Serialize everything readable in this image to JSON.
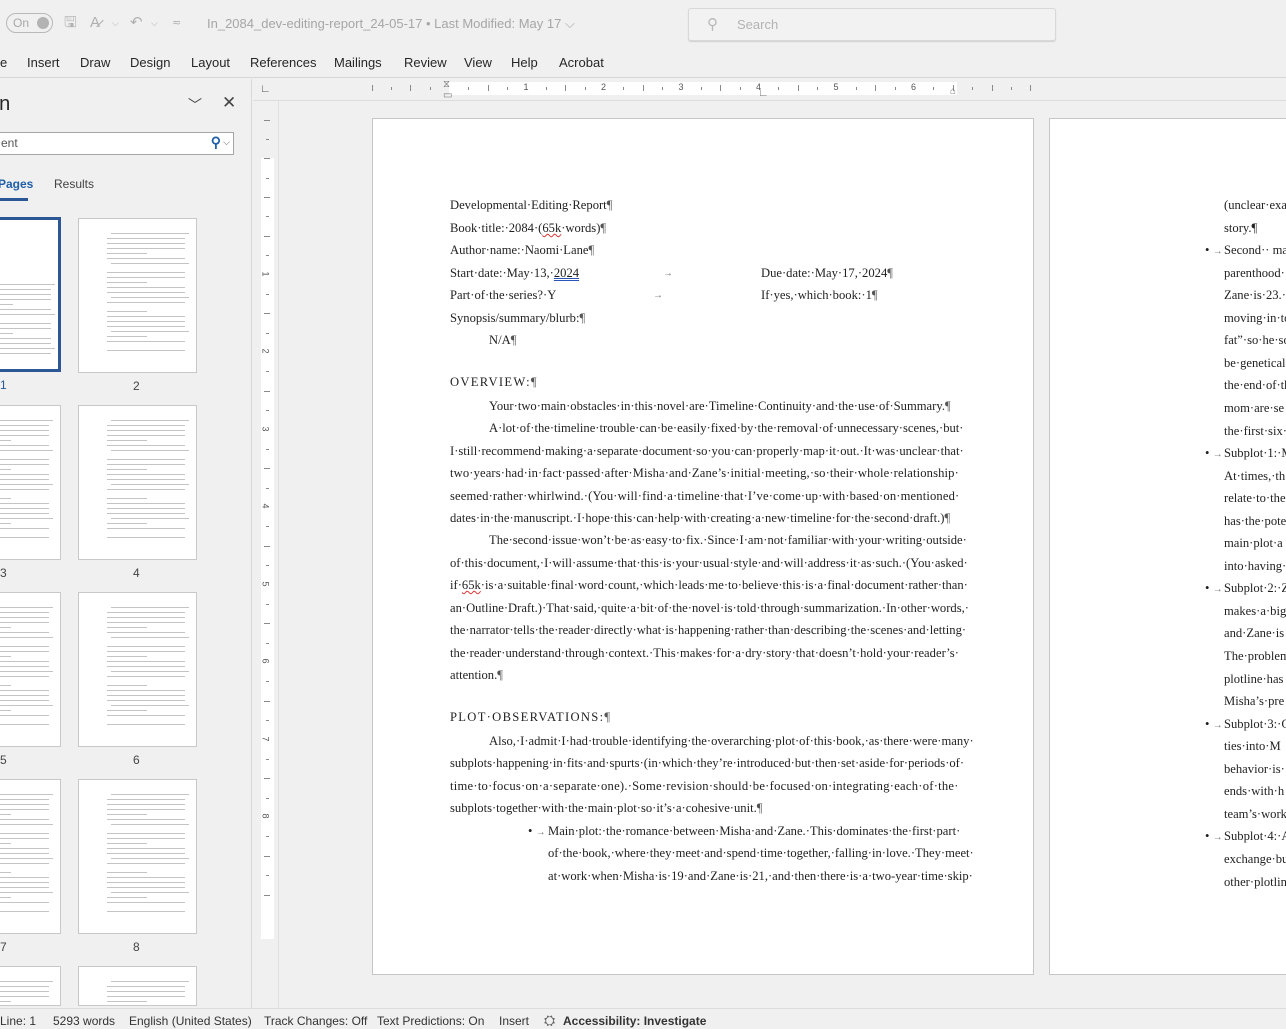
{
  "titlebar": {
    "autosave_label": "On",
    "doc_title": "In_2084_dev-editing-report_24-05-17 • Last Modified: May 17 ⌵",
    "search_placeholder": "Search",
    "icons": [
      "autosave-toggle",
      "save-icon",
      "editor-icon",
      "undo-icon",
      "customize-qat-icon"
    ]
  },
  "ribbon": {
    "tabs": [
      "e",
      "Insert",
      "Draw",
      "Design",
      "Layout",
      "References",
      "Mailings",
      "Review",
      "View",
      "Help",
      "Acrobat"
    ]
  },
  "navpane": {
    "title": "on",
    "search_value": "ent",
    "tabs": [
      {
        "label": "Pages",
        "active": true
      },
      {
        "label": "Results",
        "active": false
      }
    ],
    "thumbnails": [
      {
        "page": "1",
        "selected": true
      },
      {
        "page": "2",
        "selected": false
      },
      {
        "page": "3",
        "selected": false
      },
      {
        "page": "4",
        "selected": false
      },
      {
        "page": "5",
        "selected": false
      },
      {
        "page": "6",
        "selected": false
      },
      {
        "page": "7",
        "selected": false
      },
      {
        "page": "8",
        "selected": false
      }
    ]
  },
  "ruler": {
    "h_numbers": [
      "1",
      "2",
      "3",
      "4",
      "5",
      "6"
    ],
    "v_numbers": [
      "1",
      "2",
      "3",
      "4",
      "5",
      "6",
      "7",
      "8"
    ]
  },
  "document": {
    "page1": {
      "header_lines": [
        "Developmental·Editing·Report",
        "Book·title:·2084·(",
        "Author·name:·Naomi·Lane"
      ],
      "book_title_flagged": "65k",
      "book_title_tail": "·words)",
      "start_date_label": "Start·date:·May·13,·",
      "start_date_year": "2024",
      "due_date": "Due·date:·May·17,·2024",
      "series": "Part·of·the·series?·Y",
      "which_book": "If·yes,·which·book:·1",
      "synopsis_label": "Synopsis/summary/blurb:",
      "synopsis_value": "N/A",
      "overview_heading": "OVERVIEW:",
      "overview_lines": [
        "Your·two·main·obstacles·in·this·novel·are·Timeline·Continuity·and·the·use·of·Summary.",
        "A·lot·of·the·timeline·trouble·can·be·easily·fixed·by·the·removal·of·unnecessary·scenes,·but·",
        "I·still·recommend·making·a·separate·document·so·you·can·properly·map·it·out.·It·was·unclear·that·",
        "two·years·had·in·fact·passed·after·Misha·and·Zane’s·initial·meeting,·so·their·whole·relationship·",
        "seemed·rather·whirlwind.·(You·will·find·a·timeline·that·I’ve·come·up·with·based·on·mentioned·",
        "dates·in·the·manuscript.·I·hope·this·can·help·with·creating·a·new·timeline·for·the·second·draft.)",
        "The·second·issue·won’t·be·as·easy·to·fix.·Since·I·am·not·familiar·with·your·writing·outside·",
        "of·this·document,·I·will·assume·that·this·is·your·usual·style·and·will·address·it·as·such.·(You·asked·",
        "if·",
        "an·Outline·Draft.)·That·said,·quite·a·bit·of·the·novel·is·told·through·summarization.·In·other·words,·",
        "the·narrator·tells·the·reader·directly·what·is·happening·rather·than·describing·the·scenes·and·letting·",
        "the·reader·understand·through·context.·This·makes·for·a·dry·story·that·doesn’t·hold·your·reader’s·",
        "attention."
      ],
      "overview_flagged": "65k",
      "overview_line9_tail": "·is·a·suitable·final·word·count,·which·leads·me·to·believe·this·is·a·final·document·rather·than·",
      "plot_heading": "PLOT·OBSERVATIONS:",
      "plot_lines": [
        "Also,·I·admit·I·had·trouble·identifying·the·overarching·plot·of·this·book,·as·there·were·many·",
        "subplots·happening·in·fits·and·spurts·(in·which·they’re·introduced·but·then·set·aside·for·periods·of·",
        "time·to·focus·on·a·separate·one).·Some·revision·should·be·focused·on·integrating·each·of·the·",
        "subplots·together·with·the·main·plot·so·it’s·a·cohesive·unit."
      ],
      "bullet_lines": [
        "Main·plot:·the·romance·between·Misha·and·Zane.·This·dominates·the·first·part·",
        "of·the·book,·where·they·meet·and·spend·time·together,·falling·in·love.·They·meet·",
        "at·work·when·Misha·is·19·and·Zane·is·21,·and·then·there·is·a·two-year·time·skip·"
      ]
    },
    "page2": {
      "lines": [
        {
          "text": "(unclear·exa",
          "bullet": false
        },
        {
          "text": "story.¶",
          "bullet": false
        },
        {
          "text": "Second·· ma",
          "bullet": true
        },
        {
          "text": "parenthood·",
          "bullet": false
        },
        {
          "text": "Zane·is·23.·",
          "bullet": false
        },
        {
          "text": "moving·in·to",
          "bullet": false
        },
        {
          "text": "fat”·so·he·so",
          "bullet": false
        },
        {
          "text": "be·genetical",
          "bullet": false
        },
        {
          "text": "the·end·of·th",
          "bullet": false
        },
        {
          "text": "mom·are·se",
          "bullet": false
        },
        {
          "text": "the·first·six·",
          "bullet": false
        },
        {
          "text": "Subplot·1:·M",
          "bullet": true
        },
        {
          "text": "At·times,·th",
          "bullet": false
        },
        {
          "text": "relate·to·the",
          "bullet": false
        },
        {
          "text": "has·the·pote",
          "bullet": false
        },
        {
          "text": "main·plot·a",
          "bullet": false
        },
        {
          "text": "into·having·",
          "bullet": false
        },
        {
          "text": "Subplot·2:·Z",
          "bullet": true
        },
        {
          "text": "makes·a·big",
          "bullet": false
        },
        {
          "text": "and·Zane·is",
          "bullet": false
        },
        {
          "text": "The·problem",
          "bullet": false
        },
        {
          "text": "plotline·has",
          "bullet": false
        },
        {
          "text": "Misha’s·pre",
          "bullet": false
        },
        {
          "text": "Subplot·3:·C",
          "bullet": true
        },
        {
          "text": "ties·into·M",
          "bullet": false
        },
        {
          "text": "behavior·is·",
          "bullet": false
        },
        {
          "text": "ends·with·h",
          "bullet": false
        },
        {
          "text": "team’s·work",
          "bullet": false
        },
        {
          "text": "Subplot·4:·A",
          "bullet": true
        },
        {
          "text": "exchange·bu",
          "bullet": false
        },
        {
          "text": "other·plotlin",
          "bullet": false
        }
      ]
    },
    "pilcrow": "¶",
    "tab_arrow": "→",
    "bullet_glyph": "•"
  },
  "statusbar": {
    "line": "Line: 1",
    "words": "5293 words",
    "language": "English (United States)",
    "track_changes": "Track Changes: Off",
    "text_predictions": "Text Predictions: On",
    "mode": "Insert",
    "accessibility": "Accessibility: Investigate"
  },
  "colors": {
    "accent": "#2b5797",
    "search_icon": "#1f5fa8",
    "spell_error": "#dd3333",
    "grammar_underline": "#2a55b8"
  }
}
